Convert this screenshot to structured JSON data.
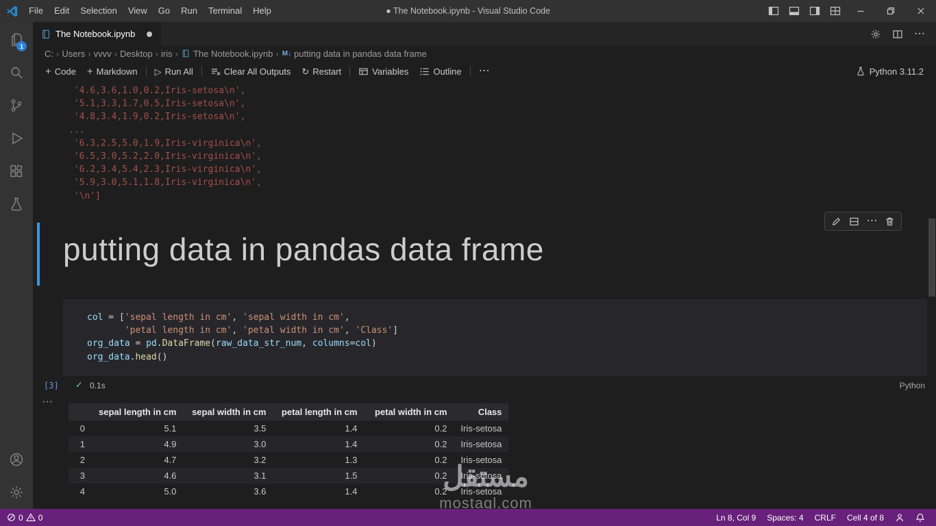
{
  "window": {
    "title": "● The Notebook.ipynb - Visual Studio Code"
  },
  "menus": [
    "File",
    "Edit",
    "Selection",
    "View",
    "Go",
    "Run",
    "Terminal",
    "Help"
  ],
  "activity_bar": {
    "explorer_badge": "1"
  },
  "tab": {
    "label": "The Notebook.ipynb"
  },
  "breadcrumb": [
    "C:",
    "Users",
    "vvvv",
    "Desktop",
    "iris",
    "The Notebook.ipynb",
    "putting data in pandas data frame"
  ],
  "toolbar": {
    "code": "Code",
    "markdown": "Markdown",
    "run_all": "Run All",
    "clear_all": "Clear All Outputs",
    "restart": "Restart",
    "variables": "Variables",
    "outline": "Outline",
    "more": "⋯",
    "kernel": "Python 3.11.2"
  },
  "output": {
    "lines": [
      " '4.6,3.6,1.0,0.2,Iris-setosa\\n',",
      " '5.1,3.3,1.7,0.5,Iris-setosa\\n',",
      " '4.8,3.4,1.9,0.2,Iris-setosa\\n',",
      "...",
      " '6.3,2.5,5.0,1.9,Iris-virginica\\n',",
      " '6.5,3.0,5.2,2.0,Iris-virginica\\n',",
      " '6.2,3.4,5.4,2.3,Iris-virginica\\n',",
      " '5.9,3.0,5.1,1.8,Iris-virginica\\n',",
      " '\\n']"
    ]
  },
  "markdown_cell": {
    "heading": "putting data in pandas data frame"
  },
  "code_cell": {
    "execution_count": "[3]",
    "duration": "0.1s",
    "language": "Python",
    "lines": [
      {
        "tokens": [
          {
            "t": "col"
          },
          {
            "t": " = ["
          },
          {
            "t": "'sepal length in cm'"
          },
          {
            "t": ", "
          },
          {
            "t": "'sepal width in cm'"
          },
          {
            "t": ","
          }
        ]
      },
      {
        "tokens": [
          {
            "t": "       "
          },
          {
            "t": "'petal length in cm'"
          },
          {
            "t": ", "
          },
          {
            "t": "'petal width in cm'"
          },
          {
            "t": ", "
          },
          {
            "t": "'Class'"
          },
          {
            "t": "]"
          }
        ]
      },
      {
        "tokens": [
          {
            "t": "org_data"
          },
          {
            "t": " = "
          },
          {
            "t": "pd"
          },
          {
            "t": "."
          },
          {
            "t": "DataFrame"
          },
          {
            "t": "("
          },
          {
            "t": "raw_data_str_num"
          },
          {
            "t": ", "
          },
          {
            "t": "columns"
          },
          {
            "t": "="
          },
          {
            "t": "col"
          },
          {
            "t": ")"
          }
        ]
      },
      {
        "tokens": [
          {
            "t": "org_data"
          },
          {
            "t": "."
          },
          {
            "t": "head"
          },
          {
            "t": "()"
          }
        ]
      }
    ]
  },
  "table": {
    "headers": [
      "",
      "sepal length in cm",
      "sepal width in cm",
      "petal length in cm",
      "petal width in cm",
      "Class"
    ],
    "rows": [
      [
        "0",
        "5.1",
        "3.5",
        "1.4",
        "0.2",
        "Iris-setosa"
      ],
      [
        "1",
        "4.9",
        "3.0",
        "1.4",
        "0.2",
        "Iris-setosa"
      ],
      [
        "2",
        "4.7",
        "3.2",
        "1.3",
        "0.2",
        "Iris-setosa"
      ],
      [
        "3",
        "4.6",
        "3.1",
        "1.5",
        "0.2",
        "Iris-setosa"
      ],
      [
        "4",
        "5.0",
        "3.6",
        "1.4",
        "0.2",
        "Iris-setosa"
      ]
    ]
  },
  "watermark": {
    "arabic": "مستقل",
    "domain": "mostaql.com"
  },
  "status_bar": {
    "errors": "0",
    "warnings": "0",
    "ln_col": "Ln 8, Col 9",
    "spaces": "Spaces: 4",
    "eol": "CRLF",
    "cell": "Cell 4 of 8"
  },
  "colors": {
    "status_bar": "#68217a",
    "activity_badge": "#2b7fd4",
    "cell_focus_bar": "#3a96dd",
    "string_token": "#ce9178",
    "variable_token": "#9cdcfe",
    "function_token": "#dcdcaa",
    "output_text": "#a6504a"
  }
}
